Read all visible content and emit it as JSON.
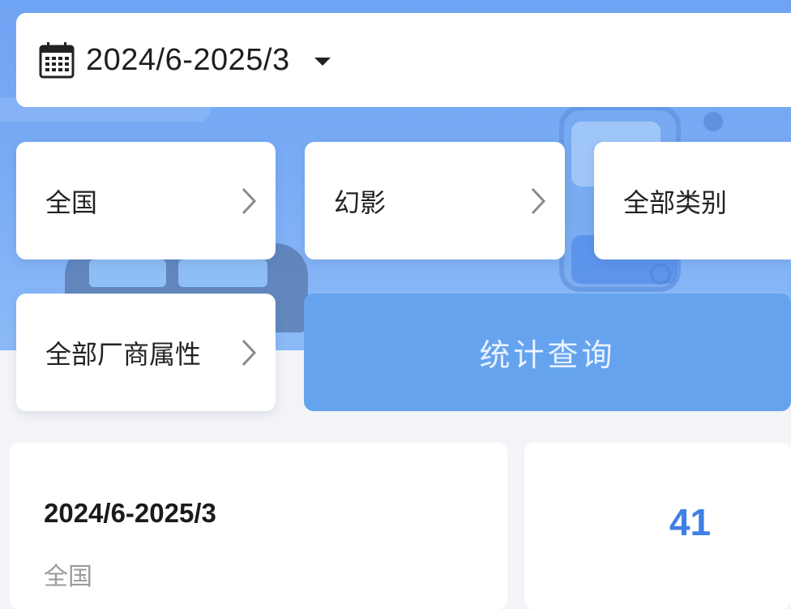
{
  "date_range": {
    "value": "2024/6-2025/3"
  },
  "filters": {
    "region": "全国",
    "model": "幻影",
    "category": "全部类别",
    "manufacturer_attr": "全部厂商属性"
  },
  "query_button": {
    "label": "统计查询"
  },
  "result": {
    "date_range": "2024/6-2025/3",
    "region": "全国",
    "count": "41"
  },
  "colors": {
    "accent": "#65a3ee",
    "count_blue": "#3f7fe6"
  },
  "icons": {
    "date": "calendar-icon",
    "dropdown": "caret-down-icon",
    "chevron": "chevron-right-icon"
  }
}
